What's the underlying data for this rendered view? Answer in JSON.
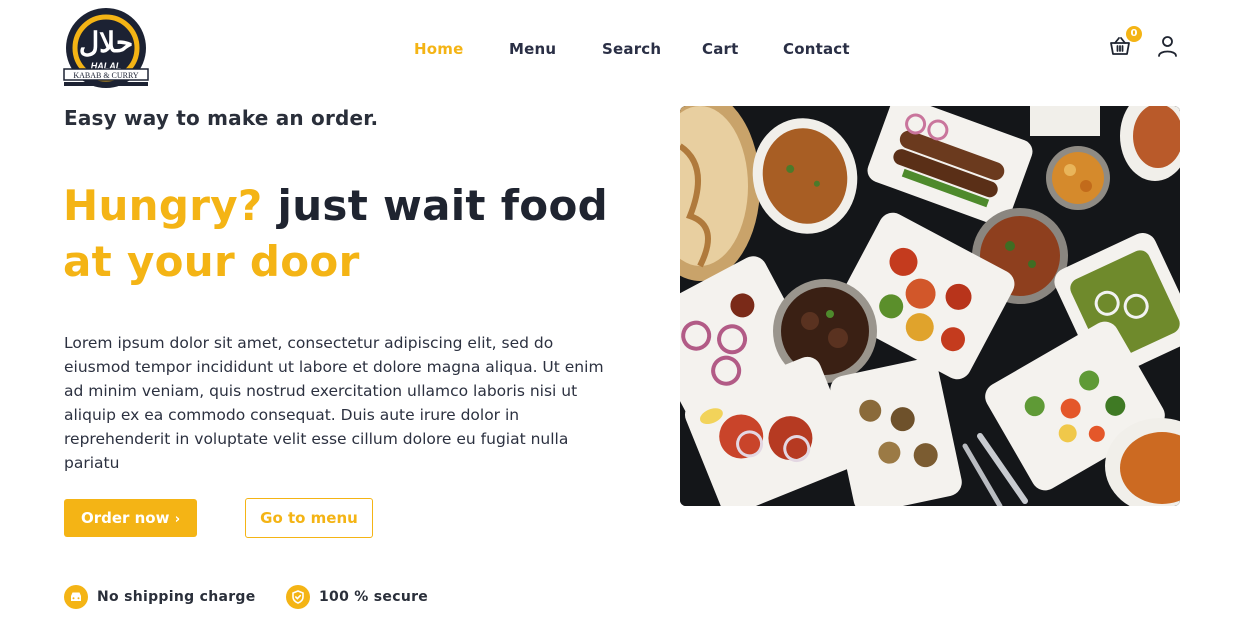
{
  "brand": {
    "arabic": "حلال",
    "name": "HALAL",
    "subtitle": "KABAB & CURRY"
  },
  "nav": {
    "items": [
      {
        "label": "Home",
        "active": true
      },
      {
        "label": "Menu",
        "active": false
      },
      {
        "label": "Search",
        "active": false
      },
      {
        "label": "Cart",
        "active": false
      },
      {
        "label": "Contact",
        "active": false
      }
    ]
  },
  "header": {
    "cart_icon": "basket-icon",
    "cart_count": "0",
    "user_icon": "user-icon"
  },
  "hero": {
    "tagline": "Easy way to make an order.",
    "headline": {
      "part1": "Hungry?",
      "part2": " just wait food ",
      "part3": "at your door"
    },
    "description": "Lorem ipsum dolor sit amet, consectetur adipiscing elit, sed do eiusmod tempor incididunt ut labore et dolore magna aliqua. Ut enim ad minim veniam, quis nostrud exercitation ullamco laboris nisi ut aliquip ex ea commodo consequat. Duis aute irure dolor in reprehenderit in voluptate velit esse cillum dolore eu fugiat nulla pariatu",
    "order_button": "Order now",
    "order_button_icon": "chevron-right-icon",
    "menu_button": "Go to menu"
  },
  "features": [
    {
      "label": "No shipping charge",
      "icon": "car-icon"
    },
    {
      "label": "100 % secure",
      "icon": "shield-icon"
    }
  ],
  "colors": {
    "accent": "#f4b415",
    "text_dark": "#1f2430",
    "nav_text": "#2a2f45"
  }
}
